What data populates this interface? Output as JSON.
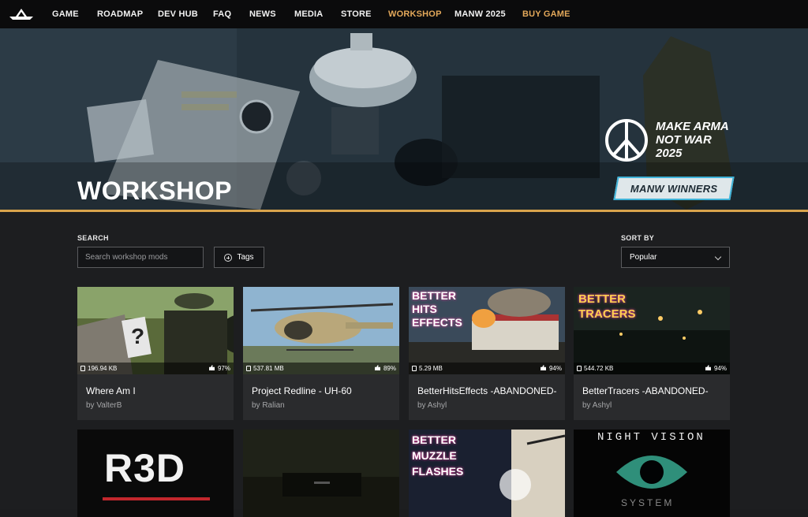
{
  "nav": {
    "items": [
      "GAME",
      "ROADMAP",
      "DEV HUB",
      "FAQ",
      "NEWS",
      "MEDIA",
      "STORE",
      "WORKSHOP",
      "MANW 2025",
      "BUY GAME"
    ],
    "active": "WORKSHOP"
  },
  "hero": {
    "title": "WORKSHOP",
    "manw_lines": [
      "MAKE ARMA",
      "NOT WAR",
      "2025"
    ],
    "manw_button": "MANW WINNERS"
  },
  "filters": {
    "search_label": "SEARCH",
    "search_placeholder": "Search workshop mods",
    "tags_label": "Tags",
    "sort_label": "SORT BY",
    "sort_value": "Popular"
  },
  "cards": [
    {
      "title": "Where Am I",
      "author": "by ValterB",
      "size": "196.94 KB",
      "rating": "97%",
      "thumb_text": ""
    },
    {
      "title": "Project Redline - UH-60",
      "author": "by Ralian",
      "size": "537.81 MB",
      "rating": "89%",
      "thumb_text": ""
    },
    {
      "title": "BetterHitsEffects -ABANDONED-",
      "author": "by Ashyl",
      "size": "5.29 MB",
      "rating": "94%",
      "thumb_text": "BETTER HITS EFFECTS"
    },
    {
      "title": "BetterTracers -ABANDONED-",
      "author": "by Ashyl",
      "size": "544.72 KB",
      "rating": "94%",
      "thumb_text": "BETTER TRACERS"
    },
    {
      "title": "",
      "author": "",
      "size": "",
      "rating": "",
      "thumb_text": "R3D"
    },
    {
      "title": "",
      "author": "",
      "size": "",
      "rating": "",
      "thumb_text": ""
    },
    {
      "title": "",
      "author": "",
      "size": "",
      "rating": "",
      "thumb_text": "BETTER MUZZLE FLASHES"
    },
    {
      "title": "",
      "author": "",
      "size": "",
      "rating": "",
      "thumb_text": "NIGHT VISION SYSTEM"
    }
  ],
  "colors": {
    "accent": "#e3a85a",
    "gold_bar": "#d9a44c",
    "manw_border": "#3fb3d8"
  }
}
